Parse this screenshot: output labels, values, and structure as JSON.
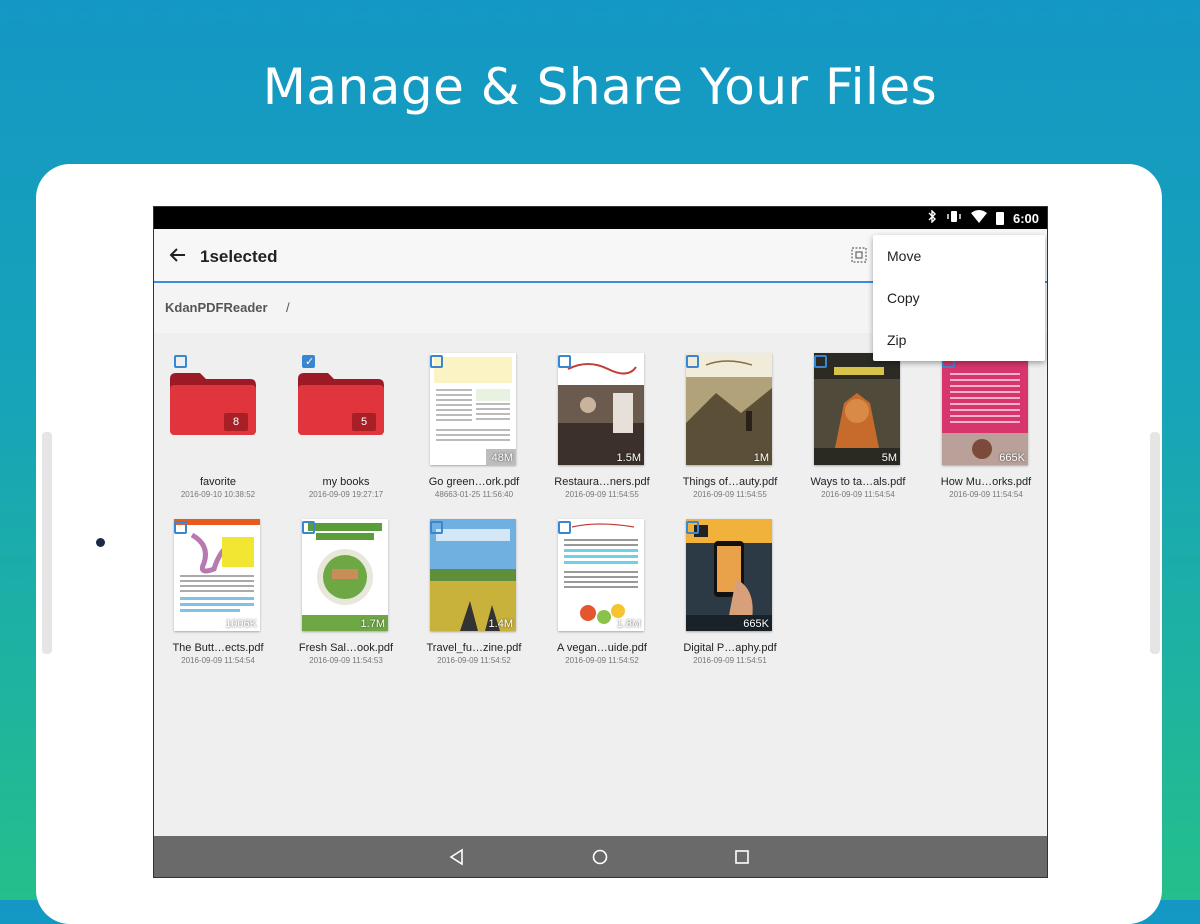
{
  "headline": "Manage & Share Your Files",
  "status": {
    "time": "6:00",
    "icons": [
      "bluetooth-icon",
      "vibrate-icon",
      "wifi-icon",
      "battery-icon"
    ]
  },
  "toolbar": {
    "title": "1selected"
  },
  "path": {
    "root": "KdanPDFReader",
    "separator": "/"
  },
  "menu": {
    "items": [
      "Move",
      "Copy",
      "Zip"
    ]
  },
  "files": [
    {
      "name": "favorite",
      "date": "2016-09-10 10:38:52",
      "kind": "folder",
      "count": "8",
      "checked": false
    },
    {
      "name": "my books",
      "date": "2016-09-09 19:27:17",
      "kind": "folder",
      "count": "5",
      "checked": true
    },
    {
      "name": "Go green…ork.pdf",
      "date": "48663-01-25 11:56:40",
      "kind": "pdf",
      "size": "48M",
      "checked": false
    },
    {
      "name": "Restaura…ners.pdf",
      "date": "2016-09-09 11:54:55",
      "kind": "pdf",
      "size": "1.5M",
      "checked": false
    },
    {
      "name": "Things of…auty.pdf",
      "date": "2016-09-09 11:54:55",
      "kind": "pdf",
      "size": "1M",
      "checked": false
    },
    {
      "name": "Ways to ta…als.pdf",
      "date": "2016-09-09 11:54:54",
      "kind": "pdf",
      "size": "5M",
      "checked": false
    },
    {
      "name": "How Mu…orks.pdf",
      "date": "2016-09-09 11:54:54",
      "kind": "pdf",
      "size": "665K",
      "checked": false
    },
    {
      "name": "The Butt…ects.pdf",
      "date": "2016-09-09 11:54:54",
      "kind": "pdf",
      "size": "1006K",
      "checked": false
    },
    {
      "name": "Fresh Sal…ook.pdf",
      "date": "2016-09-09 11:54:53",
      "kind": "pdf",
      "size": "1.7M",
      "checked": false
    },
    {
      "name": "Travel_fu…zine.pdf",
      "date": "2016-09-09 11:54:52",
      "kind": "pdf",
      "size": "1.4M",
      "checked": false
    },
    {
      "name": "A vegan…uide.pdf",
      "date": "2016-09-09 11:54:52",
      "kind": "pdf",
      "size": "1.8M",
      "checked": false
    },
    {
      "name": "Digital P…aphy.pdf",
      "date": "2016-09-09 11:54:51",
      "kind": "pdf",
      "size": "665K",
      "checked": false
    }
  ],
  "colors": {
    "accent": "#3a86cf",
    "folder": "#e0353d",
    "folderTab": "#9c1a26"
  }
}
